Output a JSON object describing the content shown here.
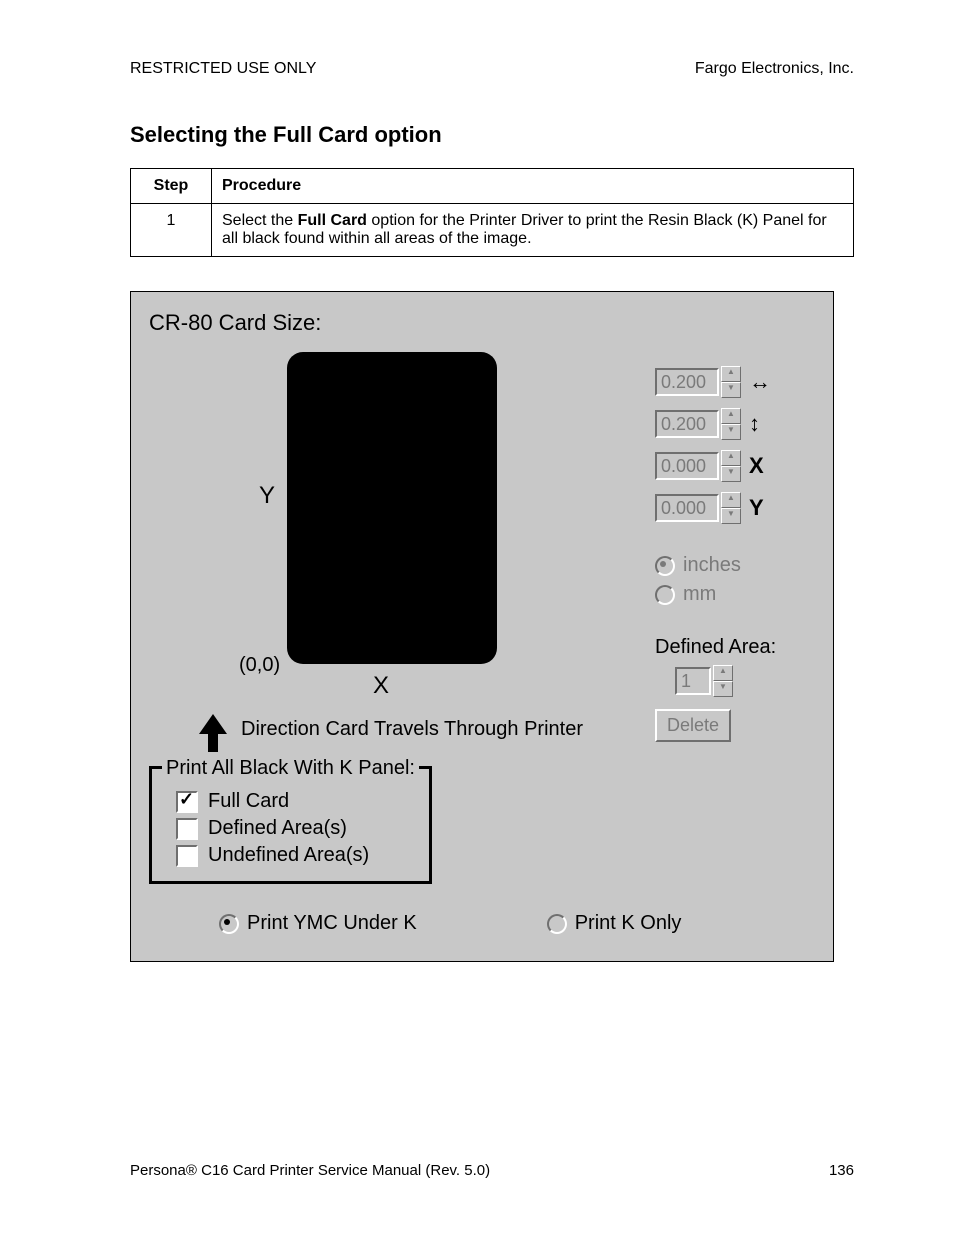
{
  "header": {
    "left": "RESTRICTED USE ONLY",
    "right": "Fargo Electronics, Inc."
  },
  "title": "Selecting the Full Card option",
  "table": {
    "head_step": "Step",
    "head_proc": "Procedure",
    "row1_step": "1",
    "row1_pre": "Select the ",
    "row1_bold": "Full Card",
    "row1_post": " option for the Printer Driver to print the Resin Black (K) Panel for all black found within all areas of the image."
  },
  "dialog": {
    "title": "CR-80 Card Size:",
    "y_label": "Y",
    "x_label": "X",
    "origin": "(0,0)",
    "direction": "Direction Card Travels Through Printer",
    "spin": {
      "w": "0.200",
      "h": "0.200",
      "x": "0.000",
      "y": "0.000"
    },
    "icons": {
      "w": "↔",
      "h": "↕",
      "x": "X",
      "y": "Y"
    },
    "units": {
      "inches": "inches",
      "mm": "mm"
    },
    "defined_area_label": "Defined Area:",
    "defined_area_value": "1",
    "delete": "Delete",
    "panel": {
      "legend": "Print All Black With K Panel:",
      "full_card": "Full Card",
      "defined": "Defined Area(s)",
      "undefined": "Undefined Area(s)"
    },
    "print_mode": {
      "ymc": "Print YMC Under K",
      "konly": "Print K Only"
    }
  },
  "footer": {
    "left_pre": "Persona",
    "left_reg": "®",
    "left_post": " C16 Card Printer Service Manual (Rev. 5.0)",
    "page": "136"
  }
}
